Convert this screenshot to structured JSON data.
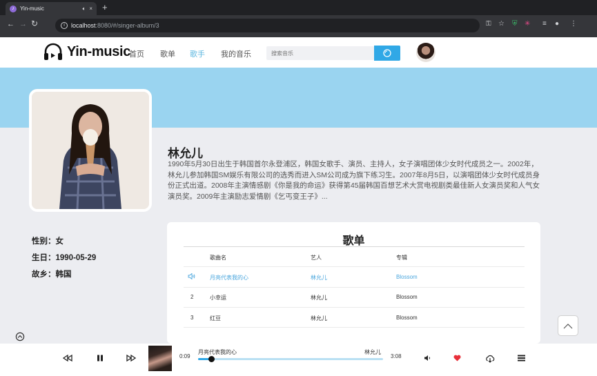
{
  "browser": {
    "tab_title": "Yin-music",
    "tab_close": "×",
    "new_tab": "+",
    "url_host": "localhost",
    "url_path": ":8080/#/singer-album/3"
  },
  "header": {
    "logo_text": "Yin-music",
    "nav": [
      "首页",
      "歌单",
      "歌手",
      "我的音乐"
    ],
    "active_nav": "歌手",
    "search_placeholder": "搜索音乐"
  },
  "singer": {
    "name": "林允儿",
    "description": "1990年5月30日出生于韩国首尔永登浦区，韩国女歌手、演员、主持人，女子演唱团体少女时代成员之一。2002年，林允儿参加韩国SM娱乐有限公司的选秀而进入SM公司成为旗下练习生。2007年8月5日，以演唱团体少女时代成员身份正式出道。2008年主演情感剧《你是我的命运》获得第45届韩国百想艺术大赏电视剧类最佳新人女演员奖和人气女演员奖。2009年主演励志爱情剧《乞丐变王子》...",
    "info": [
      "性别：女",
      "生日：1990-05-29",
      "故乡：韩国"
    ]
  },
  "songlist": {
    "title": "歌单",
    "headers": [
      "歌曲名",
      "艺人",
      "专辑"
    ],
    "rows": [
      {
        "index": "",
        "song": "月亮代表我的心",
        "artist": "林允儿",
        "album": "Blossom",
        "playing": true
      },
      {
        "index": "2",
        "song": "小幸运",
        "artist": "林允儿",
        "album": "Blossom",
        "playing": false
      },
      {
        "index": "3",
        "song": "红豆",
        "artist": "林允儿",
        "album": "Blossom",
        "playing": false
      }
    ]
  },
  "player": {
    "current_time": "0:09",
    "song": "月亮代表我的心",
    "artist": "林允儿",
    "duration": "3:08",
    "progress_fraction": 0.07
  },
  "colors": {
    "accent": "#30a8e6",
    "banner": "#9ad4f0",
    "active_text": "#4aa6dd",
    "heart": "#e8303a"
  },
  "icons": [
    "headphones-icon",
    "search-icon",
    "speaker-icon",
    "chevron-up-icon",
    "collapse-icon",
    "prev-icon",
    "pause-icon",
    "next-icon",
    "volume-icon",
    "heart-icon",
    "download-icon",
    "menu-icon"
  ]
}
